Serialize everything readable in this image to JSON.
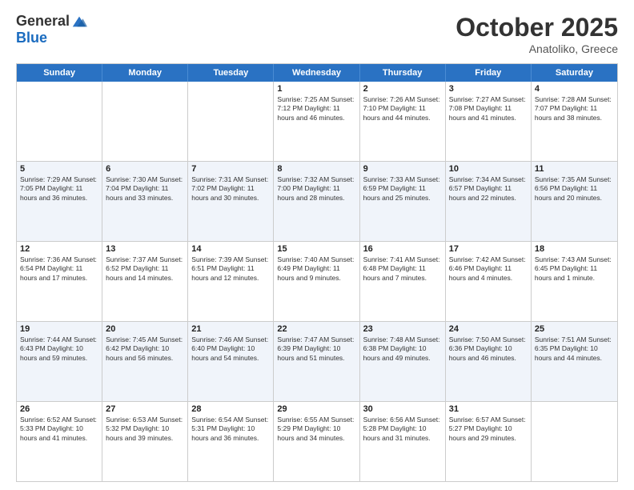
{
  "logo": {
    "general": "General",
    "blue": "Blue"
  },
  "title": "October 2025",
  "location": "Anatoliko, Greece",
  "days": [
    "Sunday",
    "Monday",
    "Tuesday",
    "Wednesday",
    "Thursday",
    "Friday",
    "Saturday"
  ],
  "weeks": [
    [
      {
        "day": "",
        "info": ""
      },
      {
        "day": "",
        "info": ""
      },
      {
        "day": "",
        "info": ""
      },
      {
        "day": "1",
        "info": "Sunrise: 7:25 AM\nSunset: 7:12 PM\nDaylight: 11 hours and 46 minutes."
      },
      {
        "day": "2",
        "info": "Sunrise: 7:26 AM\nSunset: 7:10 PM\nDaylight: 11 hours and 44 minutes."
      },
      {
        "day": "3",
        "info": "Sunrise: 7:27 AM\nSunset: 7:08 PM\nDaylight: 11 hours and 41 minutes."
      },
      {
        "day": "4",
        "info": "Sunrise: 7:28 AM\nSunset: 7:07 PM\nDaylight: 11 hours and 38 minutes."
      }
    ],
    [
      {
        "day": "5",
        "info": "Sunrise: 7:29 AM\nSunset: 7:05 PM\nDaylight: 11 hours and 36 minutes."
      },
      {
        "day": "6",
        "info": "Sunrise: 7:30 AM\nSunset: 7:04 PM\nDaylight: 11 hours and 33 minutes."
      },
      {
        "day": "7",
        "info": "Sunrise: 7:31 AM\nSunset: 7:02 PM\nDaylight: 11 hours and 30 minutes."
      },
      {
        "day": "8",
        "info": "Sunrise: 7:32 AM\nSunset: 7:00 PM\nDaylight: 11 hours and 28 minutes."
      },
      {
        "day": "9",
        "info": "Sunrise: 7:33 AM\nSunset: 6:59 PM\nDaylight: 11 hours and 25 minutes."
      },
      {
        "day": "10",
        "info": "Sunrise: 7:34 AM\nSunset: 6:57 PM\nDaylight: 11 hours and 22 minutes."
      },
      {
        "day": "11",
        "info": "Sunrise: 7:35 AM\nSunset: 6:56 PM\nDaylight: 11 hours and 20 minutes."
      }
    ],
    [
      {
        "day": "12",
        "info": "Sunrise: 7:36 AM\nSunset: 6:54 PM\nDaylight: 11 hours and 17 minutes."
      },
      {
        "day": "13",
        "info": "Sunrise: 7:37 AM\nSunset: 6:52 PM\nDaylight: 11 hours and 14 minutes."
      },
      {
        "day": "14",
        "info": "Sunrise: 7:39 AM\nSunset: 6:51 PM\nDaylight: 11 hours and 12 minutes."
      },
      {
        "day": "15",
        "info": "Sunrise: 7:40 AM\nSunset: 6:49 PM\nDaylight: 11 hours and 9 minutes."
      },
      {
        "day": "16",
        "info": "Sunrise: 7:41 AM\nSunset: 6:48 PM\nDaylight: 11 hours and 7 minutes."
      },
      {
        "day": "17",
        "info": "Sunrise: 7:42 AM\nSunset: 6:46 PM\nDaylight: 11 hours and 4 minutes."
      },
      {
        "day": "18",
        "info": "Sunrise: 7:43 AM\nSunset: 6:45 PM\nDaylight: 11 hours and 1 minute."
      }
    ],
    [
      {
        "day": "19",
        "info": "Sunrise: 7:44 AM\nSunset: 6:43 PM\nDaylight: 10 hours and 59 minutes."
      },
      {
        "day": "20",
        "info": "Sunrise: 7:45 AM\nSunset: 6:42 PM\nDaylight: 10 hours and 56 minutes."
      },
      {
        "day": "21",
        "info": "Sunrise: 7:46 AM\nSunset: 6:40 PM\nDaylight: 10 hours and 54 minutes."
      },
      {
        "day": "22",
        "info": "Sunrise: 7:47 AM\nSunset: 6:39 PM\nDaylight: 10 hours and 51 minutes."
      },
      {
        "day": "23",
        "info": "Sunrise: 7:48 AM\nSunset: 6:38 PM\nDaylight: 10 hours and 49 minutes."
      },
      {
        "day": "24",
        "info": "Sunrise: 7:50 AM\nSunset: 6:36 PM\nDaylight: 10 hours and 46 minutes."
      },
      {
        "day": "25",
        "info": "Sunrise: 7:51 AM\nSunset: 6:35 PM\nDaylight: 10 hours and 44 minutes."
      }
    ],
    [
      {
        "day": "26",
        "info": "Sunrise: 6:52 AM\nSunset: 5:33 PM\nDaylight: 10 hours and 41 minutes."
      },
      {
        "day": "27",
        "info": "Sunrise: 6:53 AM\nSunset: 5:32 PM\nDaylight: 10 hours and 39 minutes."
      },
      {
        "day": "28",
        "info": "Sunrise: 6:54 AM\nSunset: 5:31 PM\nDaylight: 10 hours and 36 minutes."
      },
      {
        "day": "29",
        "info": "Sunrise: 6:55 AM\nSunset: 5:29 PM\nDaylight: 10 hours and 34 minutes."
      },
      {
        "day": "30",
        "info": "Sunrise: 6:56 AM\nSunset: 5:28 PM\nDaylight: 10 hours and 31 minutes."
      },
      {
        "day": "31",
        "info": "Sunrise: 6:57 AM\nSunset: 5:27 PM\nDaylight: 10 hours and 29 minutes."
      },
      {
        "day": "",
        "info": ""
      }
    ]
  ]
}
